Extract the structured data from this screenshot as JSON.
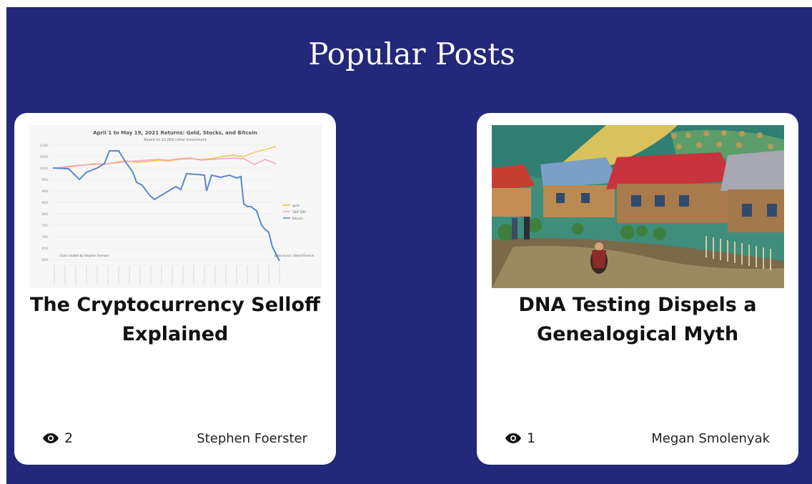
{
  "section": {
    "title": "Popular Posts"
  },
  "posts": [
    {
      "title": "The Cryptocurrency Selloff Explained",
      "views": "2",
      "author": "Stephen Foerster",
      "thumbnail": {
        "type": "line-chart",
        "chart_title": "April 1 to May 19, 2021 Returns: Gold, Stocks, and Bitcoin",
        "chart_subtitle": "Based on $1,000 initial investment",
        "y_ticks": [
          "1100",
          "1050",
          "1000",
          "950",
          "900",
          "850",
          "800",
          "750",
          "700",
          "650",
          "600"
        ],
        "legend": [
          "gold",
          "S&P 500",
          "bitcoin"
        ],
        "credit_left": "Chart created by Stephen Foerster",
        "credit_right": "Data source: Yahoo!Finance",
        "colors": {
          "gold": "#f3c04a",
          "sp500": "#f5a3b8",
          "bitcoin": "#5a88cc"
        }
      }
    },
    {
      "title": "DNA Testing Dispels a Genealogical Myth",
      "views": "1",
      "author": "Megan Smolenyak",
      "thumbnail": {
        "type": "painting",
        "subject": "village houses with red roofs and a woman on a path"
      }
    }
  ],
  "colors": {
    "background": "#22287a",
    "card": "#ffffff"
  },
  "icons": {
    "views": "eye-icon"
  }
}
